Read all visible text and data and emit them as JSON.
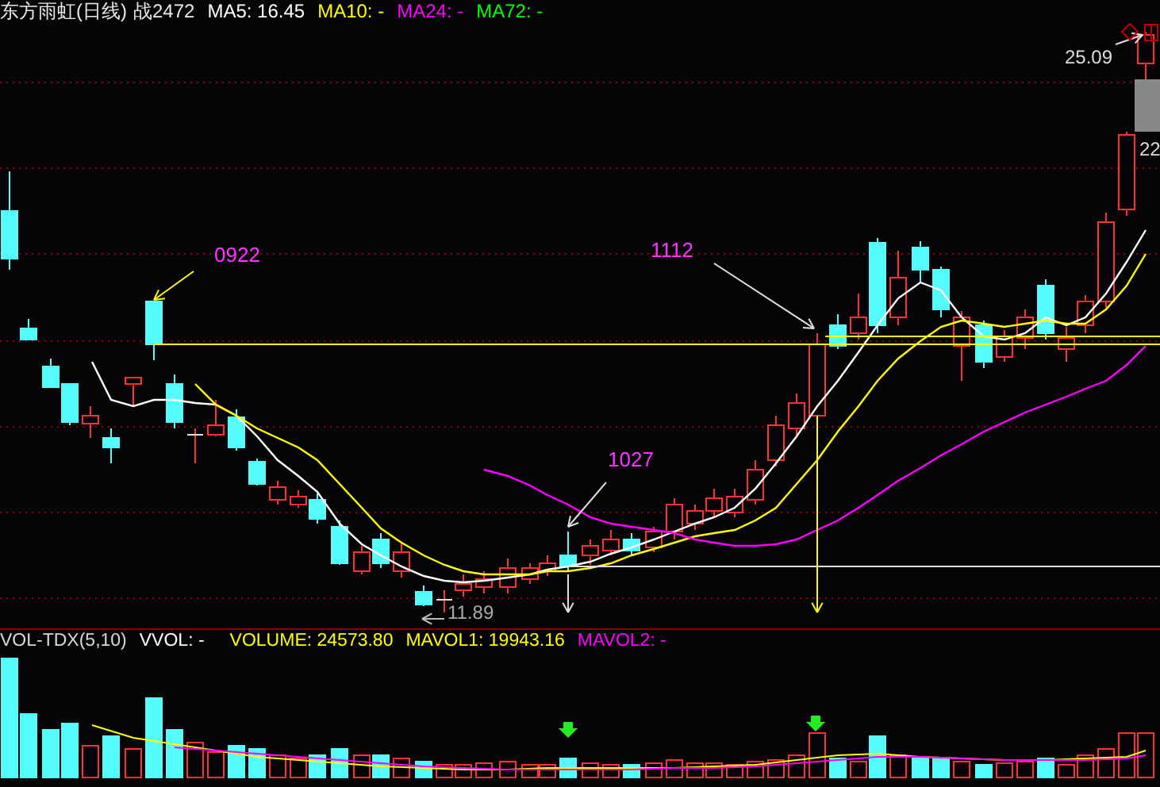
{
  "header": {
    "title": "东方雨虹(日线)",
    "code": "战2472",
    "indicators": [
      {
        "label": "MA5: 16.45",
        "color": "#ffffff"
      },
      {
        "label": "MA10: -",
        "color": "#ffff00"
      },
      {
        "label": "MA24: -",
        "color": "#ff00ff"
      },
      {
        "label": "MA72: -",
        "color": "#00ff00"
      }
    ]
  },
  "annotations": [
    {
      "text": "0922"
    },
    {
      "text": "1112"
    },
    {
      "text": "1027"
    }
  ],
  "price_labels": [
    {
      "text": "25.09"
    },
    {
      "text": "22"
    },
    {
      "text": "11.89"
    }
  ],
  "volume_panel": {
    "name": "VOL-TDX(5,10)",
    "indicators": [
      {
        "label": "VVOL: -",
        "color": "#ffffff"
      },
      {
        "label": "VOLUME: 24573.80",
        "color": "#ffff00"
      },
      {
        "label": "MAVOL1: 19943.16",
        "color": "#ffff00"
      },
      {
        "label": "MAVOL2: -",
        "color": "#ff00ff"
      }
    ]
  }
}
